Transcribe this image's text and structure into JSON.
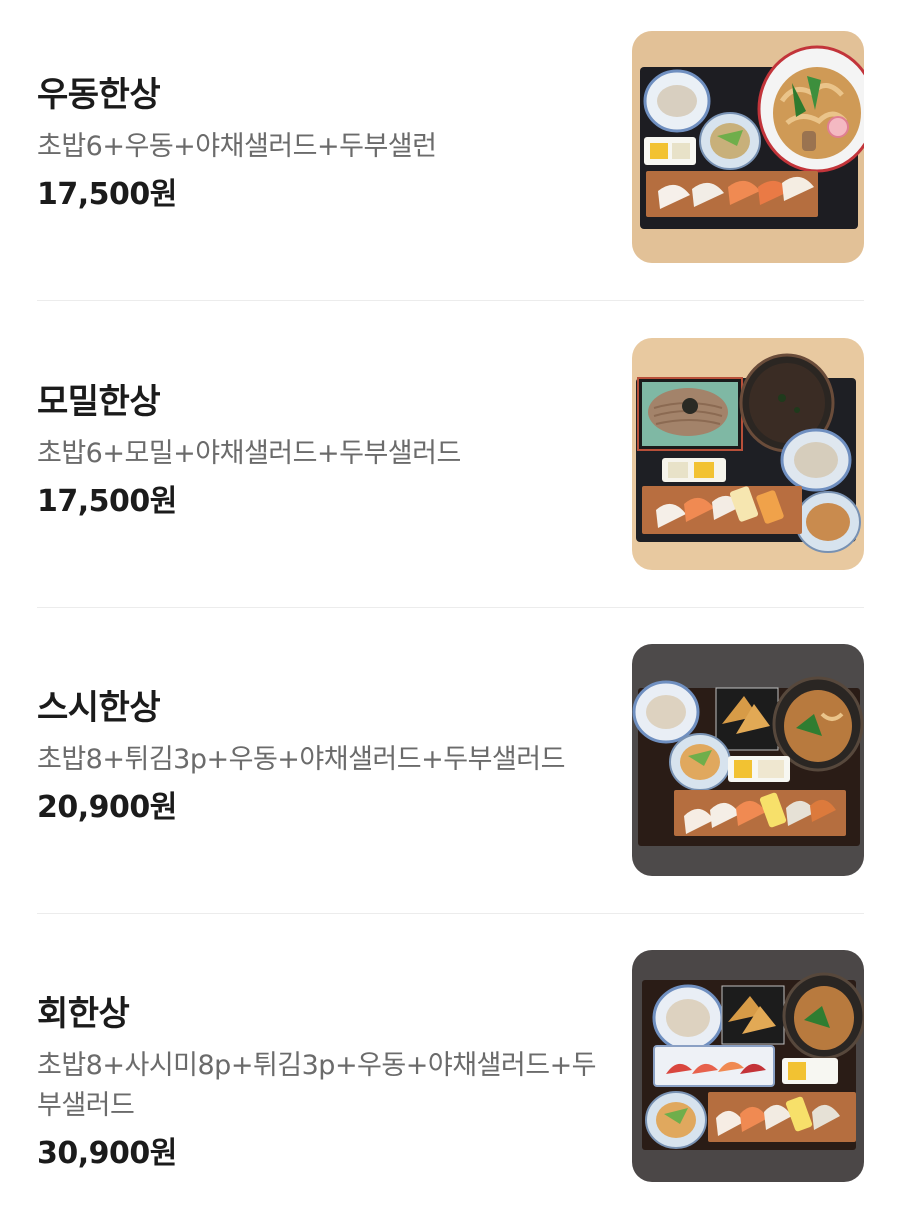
{
  "menu": {
    "items": [
      {
        "name": "우동한상",
        "description": "초밥6+우동+야채샐러드+두부샐런",
        "price": "17,500원",
        "image": "udon-set-photo"
      },
      {
        "name": "모밀한상",
        "description": "초밥6+모밀+야채샐러드+두부샐러드",
        "price": "17,500원",
        "image": "soba-set-photo"
      },
      {
        "name": "스시한상",
        "description": "초밥8+튀김3p+우동+야채샐러드+두부샐러드",
        "price": "20,900원",
        "image": "sushi-set-photo"
      },
      {
        "name": "회한상",
        "description": "초밥8+사시미8p+튀김3p+우동+야채샐러드+두부샐러드",
        "price": "30,900원",
        "image": "sashimi-set-photo"
      }
    ]
  },
  "colors": {
    "text_primary": "#1b1b1b",
    "text_secondary": "#6b6b6b",
    "divider": "#ececec",
    "wood_table": "#e8c9a0",
    "dark_table": "#4a4646"
  }
}
